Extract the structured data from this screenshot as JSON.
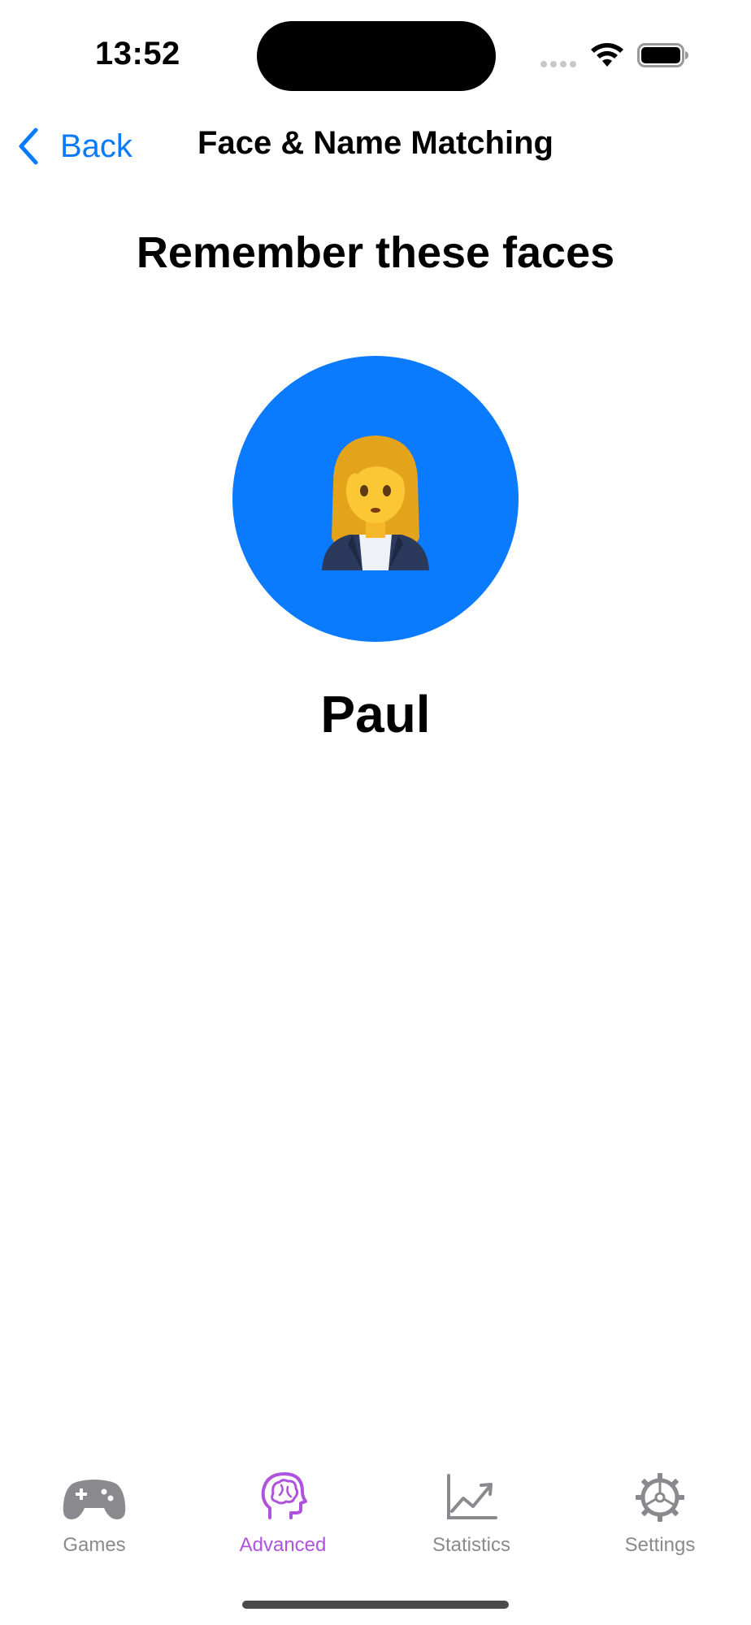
{
  "status_bar": {
    "time": "13:52"
  },
  "nav": {
    "back_label": "Back",
    "title": "Face & Name Matching"
  },
  "main": {
    "heading": "Remember these faces",
    "face_emoji": "woman-office-worker",
    "circle_color": "#0A7AFF",
    "name": "Paul"
  },
  "tab_bar": {
    "active_color": "#AF52DE",
    "inactive_color": "#8A8A8E",
    "items": [
      {
        "label": "Games",
        "icon": "gamecontroller-icon",
        "active": false
      },
      {
        "label": "Advanced",
        "icon": "brain-head-icon",
        "active": true
      },
      {
        "label": "Statistics",
        "icon": "chart-line-icon",
        "active": false
      },
      {
        "label": "Settings",
        "icon": "gear-icon",
        "active": false
      }
    ]
  }
}
